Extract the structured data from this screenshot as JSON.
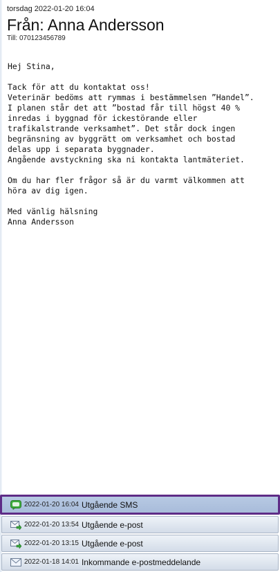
{
  "message": {
    "date": "torsdag 2022-01-20 16:04",
    "from": "Från: Anna Andersson",
    "to": "Till: 070123456789",
    "body": [
      "Hej Stina,",
      "",
      "Tack för att du kontaktat oss!",
      "Veterinär bedöms att rymmas i bestämmelsen ”Handel”.",
      "I planen står det att ”bostad får till högst 40 %",
      "inredas i byggnad för ickestörande eller",
      "trafikalstrande verksamhet”. Det står dock ingen",
      "begränsning av byggrätt om verksamhet och bostad",
      "delas upp i separata byggnader.",
      "Angående avstyckning ska ni kontakta lantmäteriet.",
      "",
      "Om du har fler frågor så är du varmt välkommen att",
      "höra av dig igen.",
      "",
      "Med vänlig hälsning",
      "Anna Andersson"
    ]
  },
  "history": [
    {
      "time": "2022-01-20 16:04",
      "label": "Utgående SMS",
      "icon": "sms-icon",
      "selected": true
    },
    {
      "time": "2022-01-20 13:54",
      "label": "Utgående e-post",
      "icon": "outgoing-email-icon",
      "selected": false
    },
    {
      "time": "2022-01-20 13:15",
      "label": "Utgående e-post",
      "icon": "outgoing-email-icon",
      "selected": false
    },
    {
      "time": "2022-01-18 14:01",
      "label": "Inkommande e-postmeddelande",
      "icon": "incoming-email-icon",
      "selected": false
    }
  ],
  "colors": {
    "selected_border": "#5e2b86",
    "selected_bg": "#a8bcda",
    "row_bg": "#dfe6ef",
    "sms_green": "#3fae3f"
  }
}
